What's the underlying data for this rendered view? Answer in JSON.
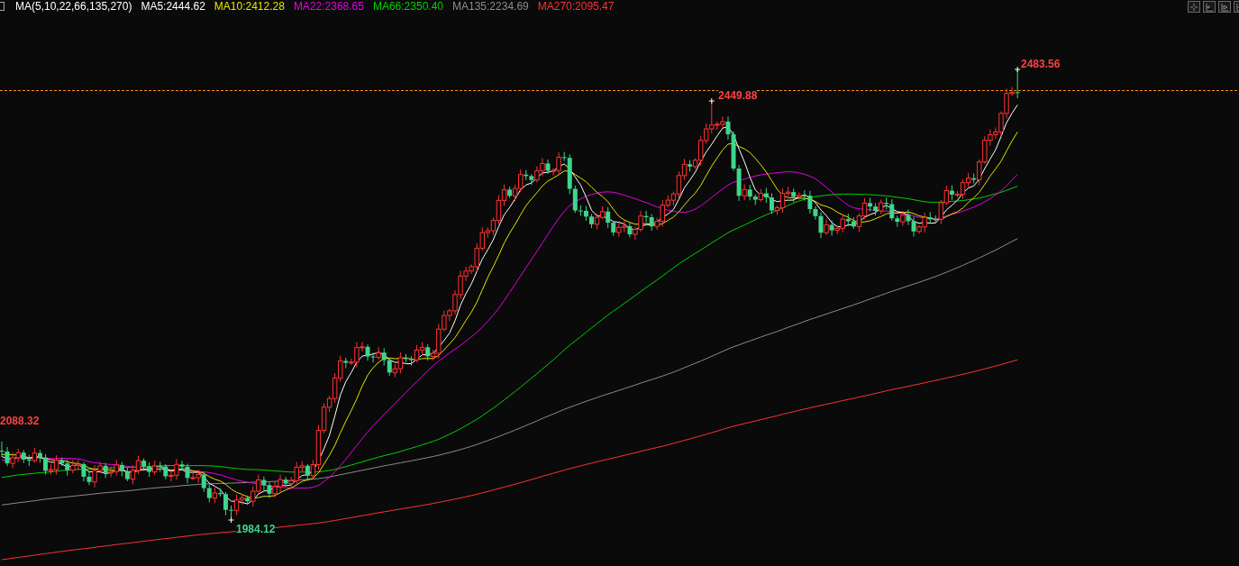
{
  "legend": [
    {
      "text": "MA(5,10,22,66,135,270)",
      "color": "#ffffff"
    },
    {
      "text": "MA5:2444.62",
      "color": "#ffffff"
    },
    {
      "text": "MA10:2412.28",
      "color": "#e6e600"
    },
    {
      "text": "MA22:2368.65",
      "color": "#e600e6"
    },
    {
      "text": "MA66:2350.40",
      "color": "#00d200"
    },
    {
      "text": "MA135:2234.69",
      "color": "#8c8c8c"
    },
    {
      "text": "MA270:2095.47",
      "color": "#ff3232"
    }
  ],
  "price_labels": [
    {
      "text": "2483.56",
      "kind": "high"
    },
    {
      "text": "2449.88",
      "kind": "high"
    },
    {
      "text": "2088.32",
      "kind": "high"
    },
    {
      "text": "1984.12",
      "kind": "low"
    }
  ]
}
